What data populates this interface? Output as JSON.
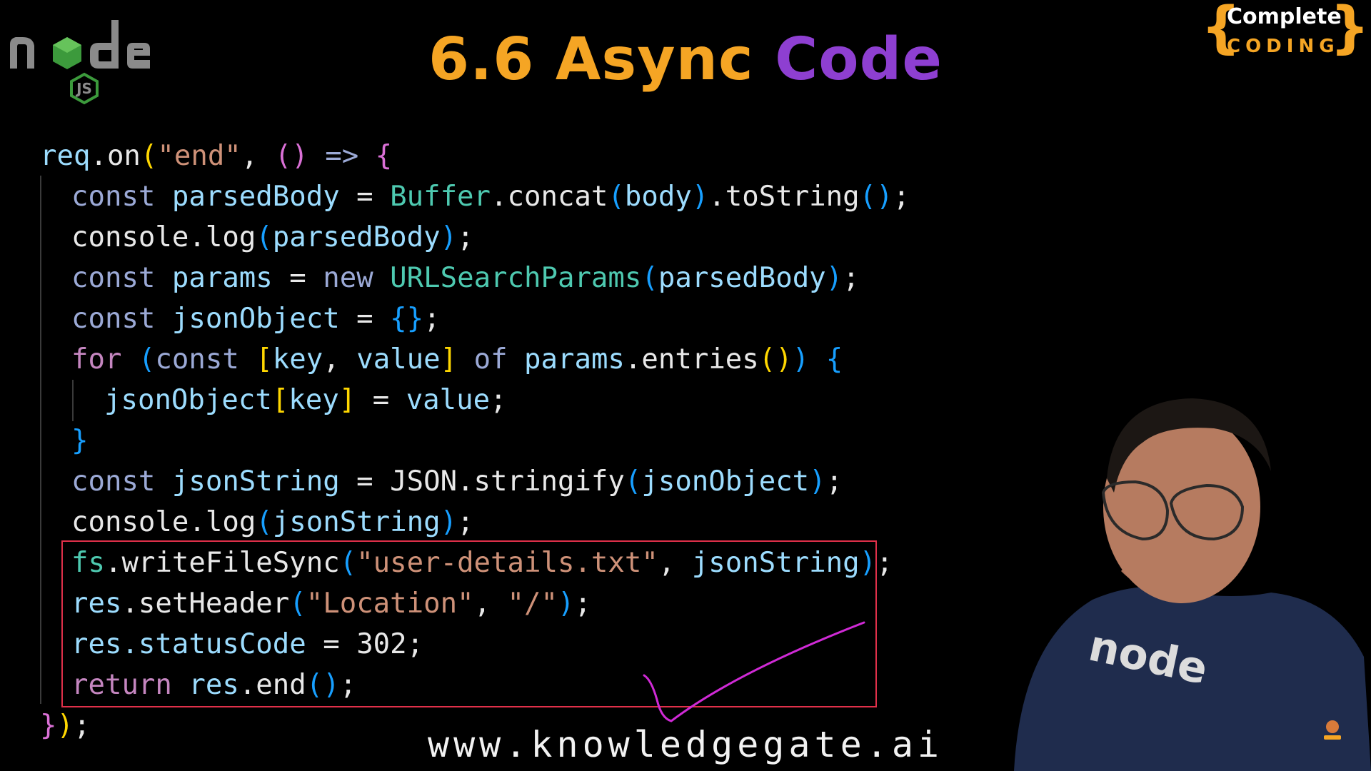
{
  "title": {
    "part1": "6.6 Async",
    "part2": "Code"
  },
  "brand": {
    "line1": "Complete",
    "line2": "CODING"
  },
  "logo": {
    "name": "node-js-logo"
  },
  "watermark": "www.knowledgegate.ai",
  "colors": {
    "title_orange": "#f5a524",
    "title_purple": "#8e3fd1",
    "highlight_box": "#e0304a",
    "annotation": "#d02ad6"
  },
  "code": {
    "l1": {
      "a": "req",
      "b": ".",
      "c": "on",
      "d": "(",
      "e": "\"end\"",
      "f": ", ",
      "g": "()",
      "h": " => ",
      "i": "{"
    },
    "l2": {
      "a": "const",
      "b": " parsedBody",
      "c": " = ",
      "d": "Buffer",
      "e": ".concat",
      "f": "(",
      "g": "body",
      "h": ")",
      "i": ".toString",
      "j": "()",
      "k": ";"
    },
    "l3": {
      "a": "console",
      "b": ".log",
      "c": "(",
      "d": "parsedBody",
      "e": ")",
      "f": ";"
    },
    "l4": {
      "a": "const",
      "b": " params",
      "c": " = ",
      "d": "new",
      "e": " URLSearchParams",
      "f": "(",
      "g": "parsedBody",
      "h": ")",
      "i": ";"
    },
    "l5": {
      "a": "const",
      "b": " jsonObject",
      "c": " = ",
      "d": "{}",
      "e": ";"
    },
    "l6": {
      "a": "for",
      "b": " (",
      "c": "const",
      "d": " [",
      "e": "key",
      "f": ", ",
      "g": "value",
      "h": "]",
      "i": " of ",
      "j": "params",
      "k": ".entries",
      "l": "()",
      "m": ")",
      "n": " {"
    },
    "l7": {
      "a": "jsonObject",
      "b": "[",
      "c": "key",
      "d": "]",
      "e": " = ",
      "f": "value",
      "g": ";"
    },
    "l8": {
      "a": "}"
    },
    "l9": {
      "a": "const",
      "b": " jsonString",
      "c": " = ",
      "d": "JSON",
      "e": ".stringify",
      "f": "(",
      "g": "jsonObject",
      "h": ")",
      "i": ";"
    },
    "l10": {
      "a": "console",
      "b": ".log",
      "c": "(",
      "d": "jsonString",
      "e": ")",
      "f": ";"
    },
    "l11": {
      "a": "fs",
      "b": ".writeFileSync",
      "c": "(",
      "d": "\"user-details.txt\"",
      "e": ", ",
      "f": "jsonString",
      "g": ")",
      "h": ";"
    },
    "l12": {
      "a": "res",
      "b": ".setHeader",
      "c": "(",
      "d": "\"Location\"",
      "e": ", ",
      "f": "\"/\"",
      "g": ")",
      "h": ";"
    },
    "l13": {
      "a": "res",
      "b": ".statusCode",
      "c": " = ",
      "d": "302",
      "e": ";"
    },
    "l14": {
      "a": "return",
      "b": " res",
      "c": ".end",
      "d": "()",
      "e": ";"
    },
    "l15": {
      "a": "}",
      "b": ")",
      "c": ";"
    }
  }
}
